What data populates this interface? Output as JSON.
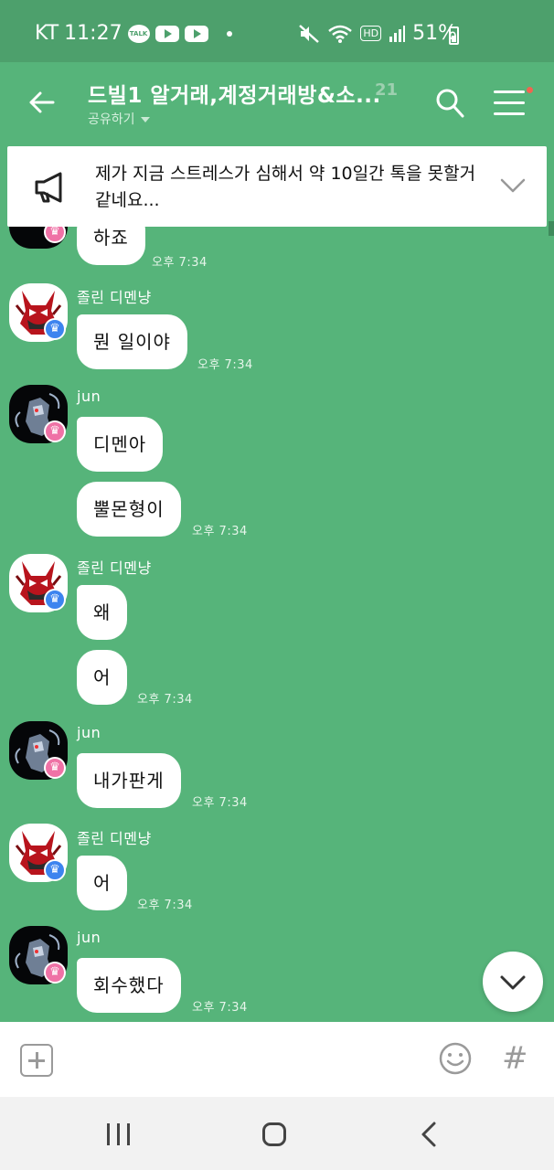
{
  "status_bar": {
    "carrier": "KT",
    "time": "11:27",
    "talk_icon_label": "TALK",
    "battery": "51%",
    "hd": "HD"
  },
  "header": {
    "title": "드빌1 알거래,계정거래방&소...",
    "member_count": "21",
    "share_label": "공유하기"
  },
  "notice": {
    "text": "제가 지금 스트레스가 심해서 약 10일간 톡을 못할거 같네요..."
  },
  "messages": [
    {
      "sender": "",
      "text": "하죠",
      "time": "오후 7:34"
    },
    {
      "sender": "졸린 디멘냥",
      "text": "뭔 일이야",
      "time": "오후 7:34"
    },
    {
      "sender": "jun",
      "text": "디멘아",
      "time": ""
    },
    {
      "sender": "",
      "text": "뿔몬형이",
      "time": "오후 7:34"
    },
    {
      "sender": "졸린 디멘냥",
      "text": "왜",
      "time": ""
    },
    {
      "sender": "",
      "text": "어",
      "time": "오후 7:34"
    },
    {
      "sender": "jun",
      "text": "내가판게",
      "time": "오후 7:34"
    },
    {
      "sender": "졸린 디멘냥",
      "text": "어",
      "time": "오후 7:34"
    },
    {
      "sender": "jun",
      "text": "회수했다",
      "time": "오후 7:34"
    }
  ],
  "icons": {
    "back": "arrow-left-icon",
    "search": "search-icon",
    "menu": "hamburger-menu-icon",
    "notice": "megaphone-icon",
    "expand": "chevron-down-icon",
    "attach": "plus-square-icon",
    "emoji": "smiley-icon",
    "hashtag": "#",
    "scroll_down": "chevron-down-icon"
  },
  "colors": {
    "chat_background": "#56b47a",
    "status_bar": "#4da06c",
    "bubble": "#ffffff",
    "notification_dot": "#f16550"
  }
}
